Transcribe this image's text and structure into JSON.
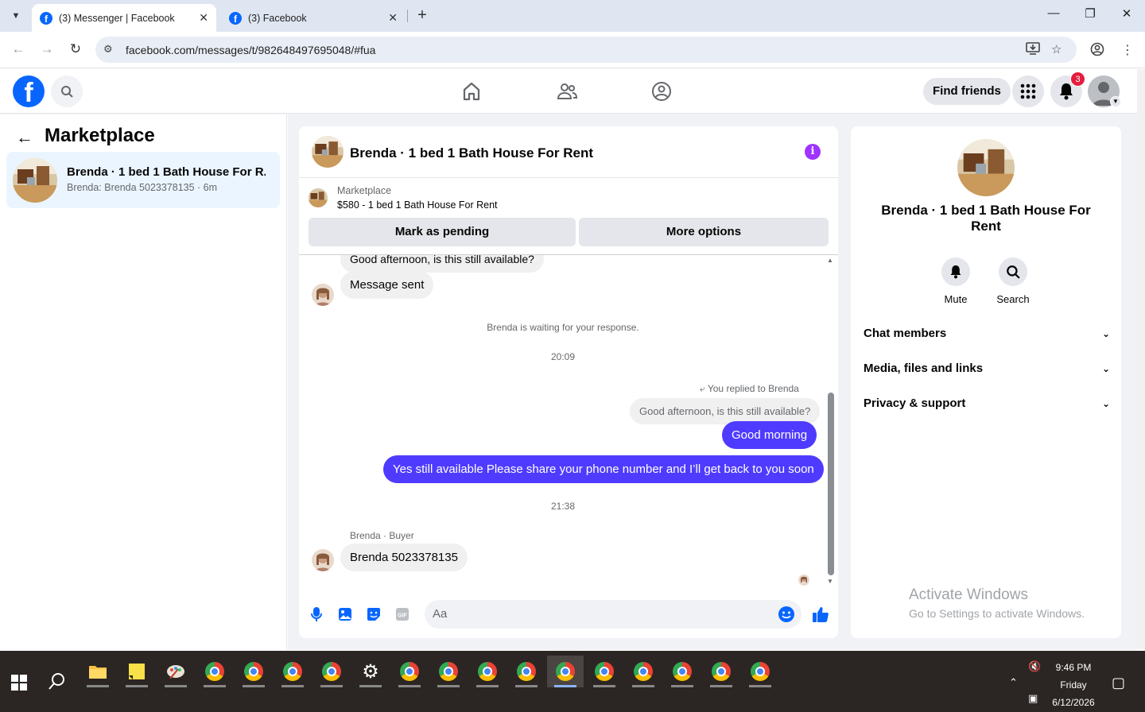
{
  "browser": {
    "tabs": [
      {
        "title": "(3) Messenger | Facebook",
        "active": true
      },
      {
        "title": "(3) Facebook",
        "active": false
      }
    ],
    "url": "facebook.com/messages/t/982648497695048/#fua"
  },
  "header": {
    "find_friends": "Find friends",
    "notification_count": "3"
  },
  "left": {
    "title": "Marketplace",
    "conversation": {
      "name": "Brenda · 1 bed 1 Bath House For R...",
      "snippet": "Brenda: Brenda 5023378135 · 6m"
    }
  },
  "chat": {
    "title": "Brenda · 1 bed 1 Bath House For Rent",
    "marketplace_label": "Marketplace",
    "listing": "$580 - 1 bed 1 Bath House For Rent",
    "mark_pending": "Mark as pending",
    "more_options": "More options",
    "messages": {
      "top_partial": "Good afternoon, is this still available?",
      "message_sent": "Message sent",
      "waiting": "Brenda is waiting for your response.",
      "time1": "20:09",
      "replied_to": "You replied to Brenda",
      "quoted": "Good afternoon, is this still available?",
      "out1": "Good morning",
      "out2": "Yes still available Please share your phone number and I’ll get back to you soon",
      "time2": "21:38",
      "sender_label": "Brenda · Buyer",
      "in_last": "Brenda 5023378135"
    },
    "composer_placeholder": "Aa"
  },
  "right": {
    "name": "Brenda · 1 bed 1 Bath House For Rent",
    "mute": "Mute",
    "search": "Search",
    "sections": [
      "Chat members",
      "Media, files and links",
      "Privacy & support"
    ]
  },
  "watermark": {
    "line1": "Activate Windows",
    "line2": "Go to Settings to activate Windows."
  },
  "taskbar": {
    "time": "9:46 PM",
    "day": "Friday",
    "date": "6/12/2026"
  },
  "colors": {
    "fb_blue": "#0866ff",
    "outgoing_bubble": "#4f3bff",
    "badge_red": "#e41e3f",
    "info_purple": "#a033ff"
  }
}
